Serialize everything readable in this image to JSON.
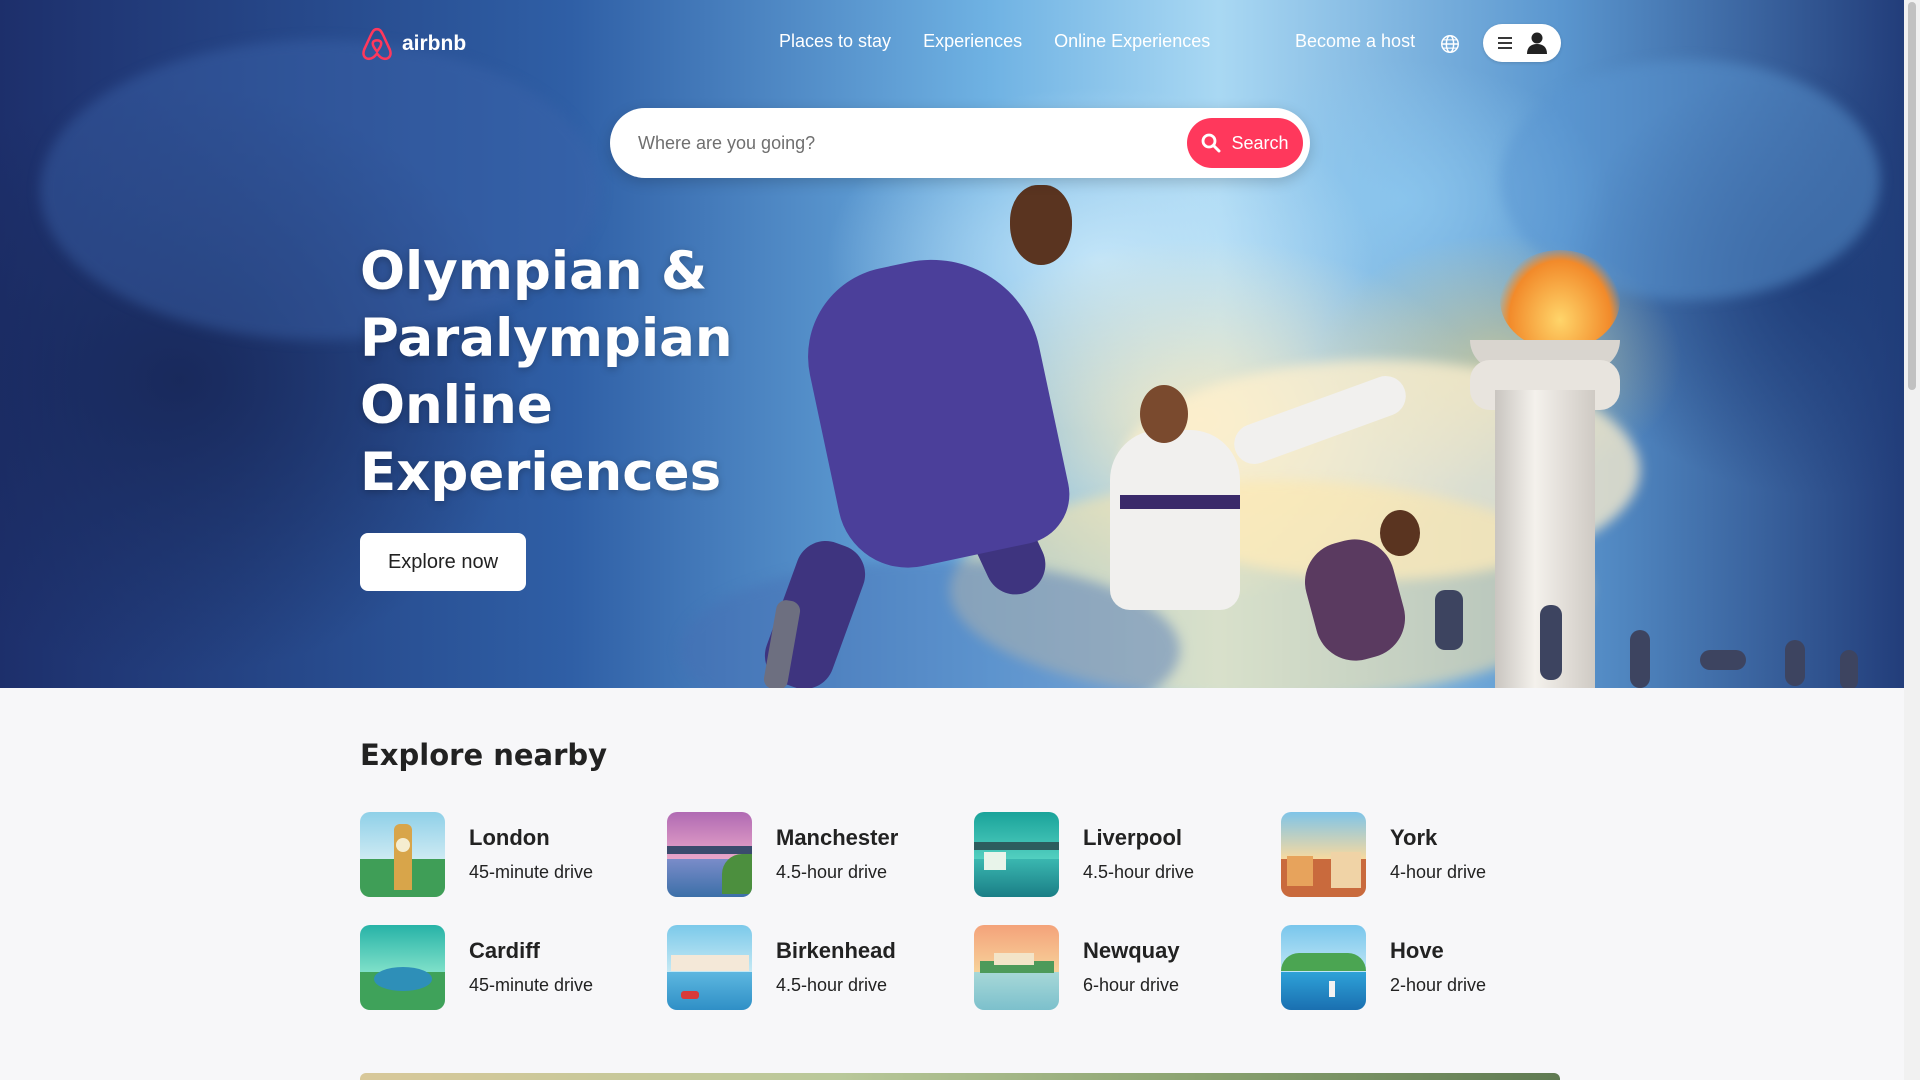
{
  "brand": {
    "name": "airbnb",
    "color": "#ff385c"
  },
  "nav": {
    "links": [
      "Places to stay",
      "Experiences",
      "Online Experiences"
    ],
    "host_label": "Become a host",
    "globe_icon": "globe-icon",
    "menu_icons": [
      "hamburger-icon",
      "user-icon"
    ]
  },
  "search": {
    "placeholder": "Where are you going?",
    "button_label": "Search"
  },
  "hero": {
    "title": "Olympian & Paralympian Online Experiences",
    "cta_label": "Explore now"
  },
  "nearby": {
    "title": "Explore nearby",
    "places": [
      {
        "name": "London",
        "distance": "45-minute drive"
      },
      {
        "name": "Manchester",
        "distance": "4.5-hour drive"
      },
      {
        "name": "Liverpool",
        "distance": "4.5-hour drive"
      },
      {
        "name": "York",
        "distance": "4-hour drive"
      },
      {
        "name": "Cardiff",
        "distance": "45-minute drive"
      },
      {
        "name": "Birkenhead",
        "distance": "4.5-hour drive"
      },
      {
        "name": "Newquay",
        "distance": "6-hour drive"
      },
      {
        "name": "Hove",
        "distance": "2-hour drive"
      }
    ]
  }
}
